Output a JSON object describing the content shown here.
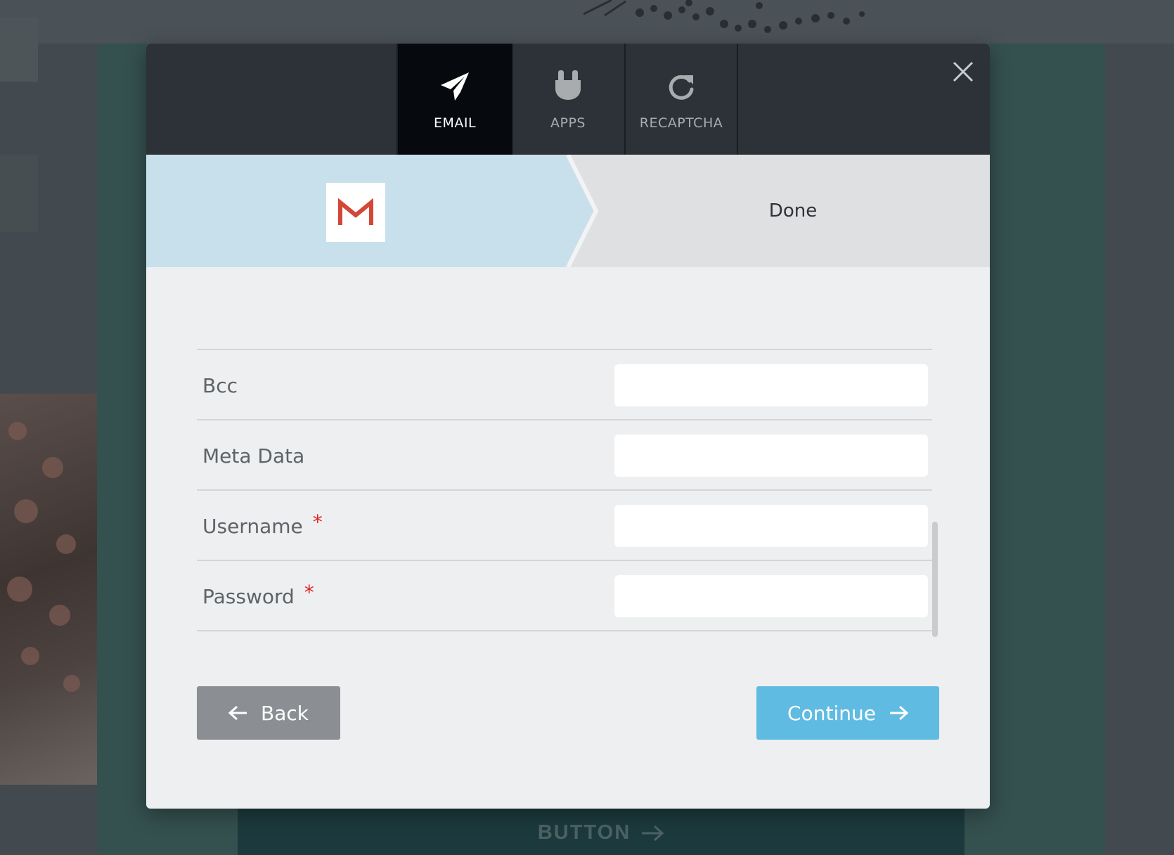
{
  "background": {
    "cta_label": "BUTTON"
  },
  "modal": {
    "tabs": [
      {
        "label": "EMAIL",
        "icon": "paper-plane-icon",
        "active": true
      },
      {
        "label": "APPS",
        "icon": "plug-icon",
        "active": false
      },
      {
        "label": "RECAPTCHA",
        "icon": "refresh-icon",
        "active": false
      }
    ],
    "close_icon": "close-icon",
    "stepper": {
      "provider": "gmail-logo",
      "next_step_label": "Done"
    },
    "form": {
      "fields": [
        {
          "label": "Bcc",
          "required": false,
          "value": "",
          "placeholder": ""
        },
        {
          "label": "Meta Data",
          "required": false,
          "value": "",
          "placeholder": ""
        },
        {
          "label": "Username",
          "required": true,
          "value": "",
          "placeholder": ""
        },
        {
          "label": "Password",
          "required": true,
          "value": "",
          "placeholder": ""
        }
      ],
      "required_marker": "*"
    },
    "buttons": {
      "back_label": "Back",
      "continue_label": "Continue"
    }
  },
  "colors": {
    "header_bg": "#2d3138",
    "active_tab_bg": "#060a0f",
    "stepper_active_bg": "#c7e0ec",
    "stepper_inactive_bg": "#dfe0e2",
    "continue_bg": "#5fbbe2",
    "back_bg": "#8b8e92",
    "required": "#e02424",
    "gmail_red": "#d44638"
  }
}
